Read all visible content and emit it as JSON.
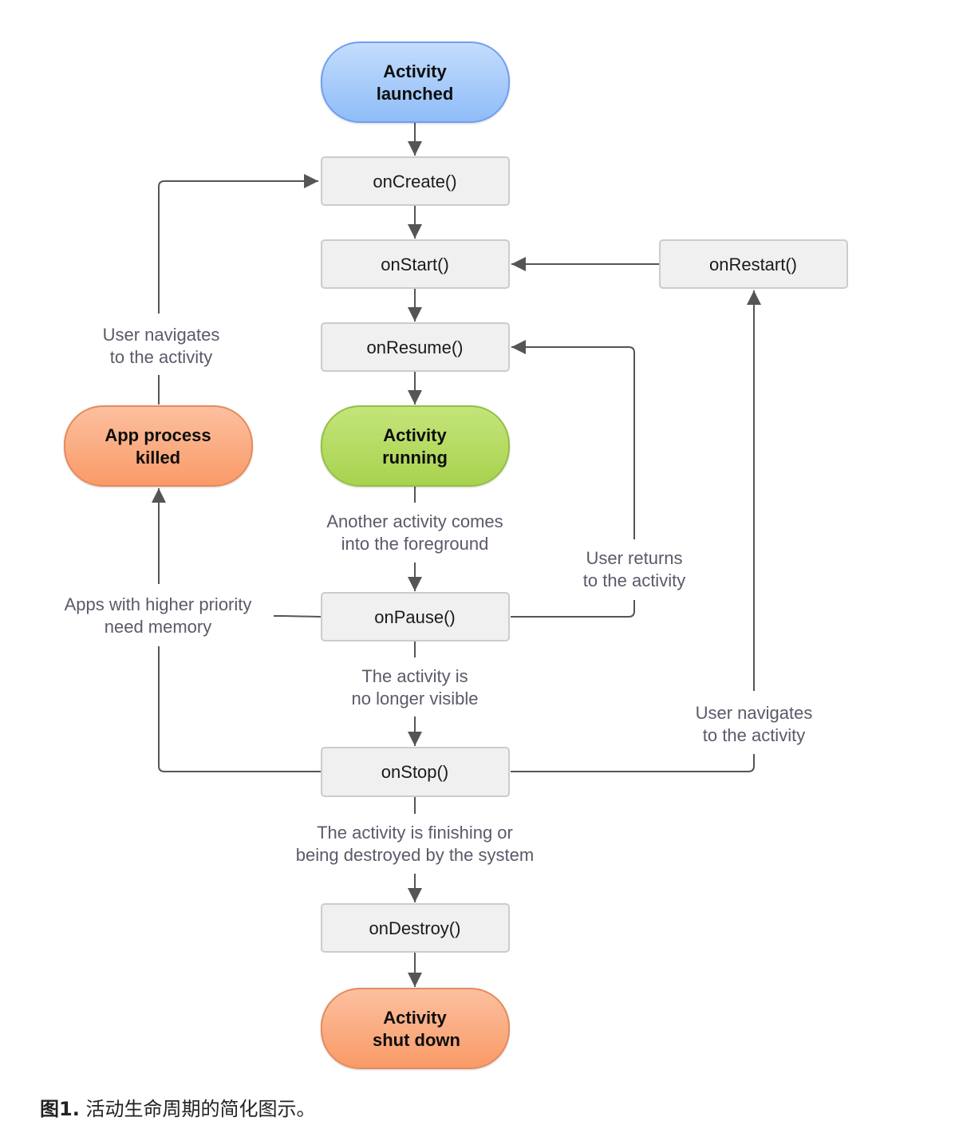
{
  "colors": {
    "blue_fill": "#a9cdfb",
    "blue_stroke": "#6a9ff0",
    "green_fill": "#b9df63",
    "green_stroke": "#93bf45",
    "orange_fill": "#fbb08a",
    "orange_stroke": "#e58a5e",
    "box_fill": "#f0f0f0",
    "box_stroke": "#cccccc",
    "line": "#555555"
  },
  "nodes": {
    "activity_launched": {
      "line1": "Activity",
      "line2": "launched"
    },
    "on_create": "onCreate()",
    "on_start": "onStart()",
    "on_restart": "onRestart()",
    "on_resume": "onResume()",
    "activity_running": {
      "line1": "Activity",
      "line2": "running"
    },
    "app_process_killed": {
      "line1": "App process",
      "line2": "killed"
    },
    "on_pause": "onPause()",
    "on_stop": "onStop()",
    "on_destroy": "onDestroy()",
    "activity_shut_down": {
      "line1": "Activity",
      "line2": "shut down"
    }
  },
  "labels": {
    "user_navigates_left": {
      "line1": "User navigates",
      "line2": "to the activity"
    },
    "another_activity": {
      "line1": "Another activity comes",
      "line2": "into the foreground"
    },
    "user_returns": {
      "line1": "User returns",
      "line2": "to the activity"
    },
    "apps_higher_priority": {
      "line1": "Apps with higher priority",
      "line2": "need memory"
    },
    "no_longer_visible": {
      "line1": "The activity is",
      "line2": "no longer visible"
    },
    "user_navigates_right": {
      "line1": "User navigates",
      "line2": "to the activity"
    },
    "finishing": {
      "line1": "The activity is finishing or",
      "line2": "being destroyed by the system"
    }
  },
  "caption": {
    "figure": "图1.",
    "text": " 活动生命周期的简化图示。"
  }
}
